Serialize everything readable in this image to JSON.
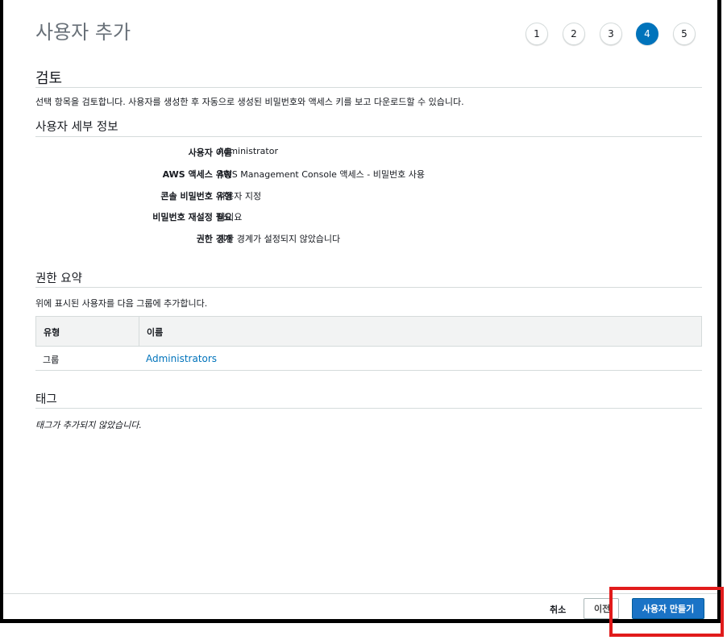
{
  "header": {
    "title": "사용자 추가",
    "steps": [
      "1",
      "2",
      "3",
      "4",
      "5"
    ],
    "active_step": "4"
  },
  "review": {
    "title": "검토",
    "description": "선택 항목을 검토합니다. 사용자를 생성한 후 자동으로 생성된 비밀번호와 액세스 키를 보고 다운로드할 수 있습니다."
  },
  "user_details": {
    "title": "사용자 세부 정보",
    "rows": [
      {
        "label": "사용자 이름",
        "value": "Administrator"
      },
      {
        "label": "AWS 액세스 유형",
        "value": "AWS Management Console 액세스 - 비밀번호 사용"
      },
      {
        "label": "콘솔 비밀번호 유형",
        "value": "사용자 지정"
      },
      {
        "label": "비밀번호 재설정 필요",
        "value": "아니요"
      },
      {
        "label": "권한 경계",
        "value": "권한 경계가 설정되지 않았습니다"
      }
    ]
  },
  "permissions": {
    "title": "권한 요약",
    "description": "위에 표시된 사용자를 다음 그룹에 추가합니다.",
    "columns": [
      "유형",
      "이름"
    ],
    "rows": [
      {
        "type": "그룹",
        "name": "Administrators"
      }
    ]
  },
  "tags": {
    "title": "태그",
    "empty_text": "태그가 추가되지 않았습니다."
  },
  "footer": {
    "cancel_label": "취소",
    "prev_label": "이전",
    "create_label": "사용자 만들기"
  },
  "colors": {
    "primary": "#0073bb",
    "highlight": "#e11b1b"
  }
}
